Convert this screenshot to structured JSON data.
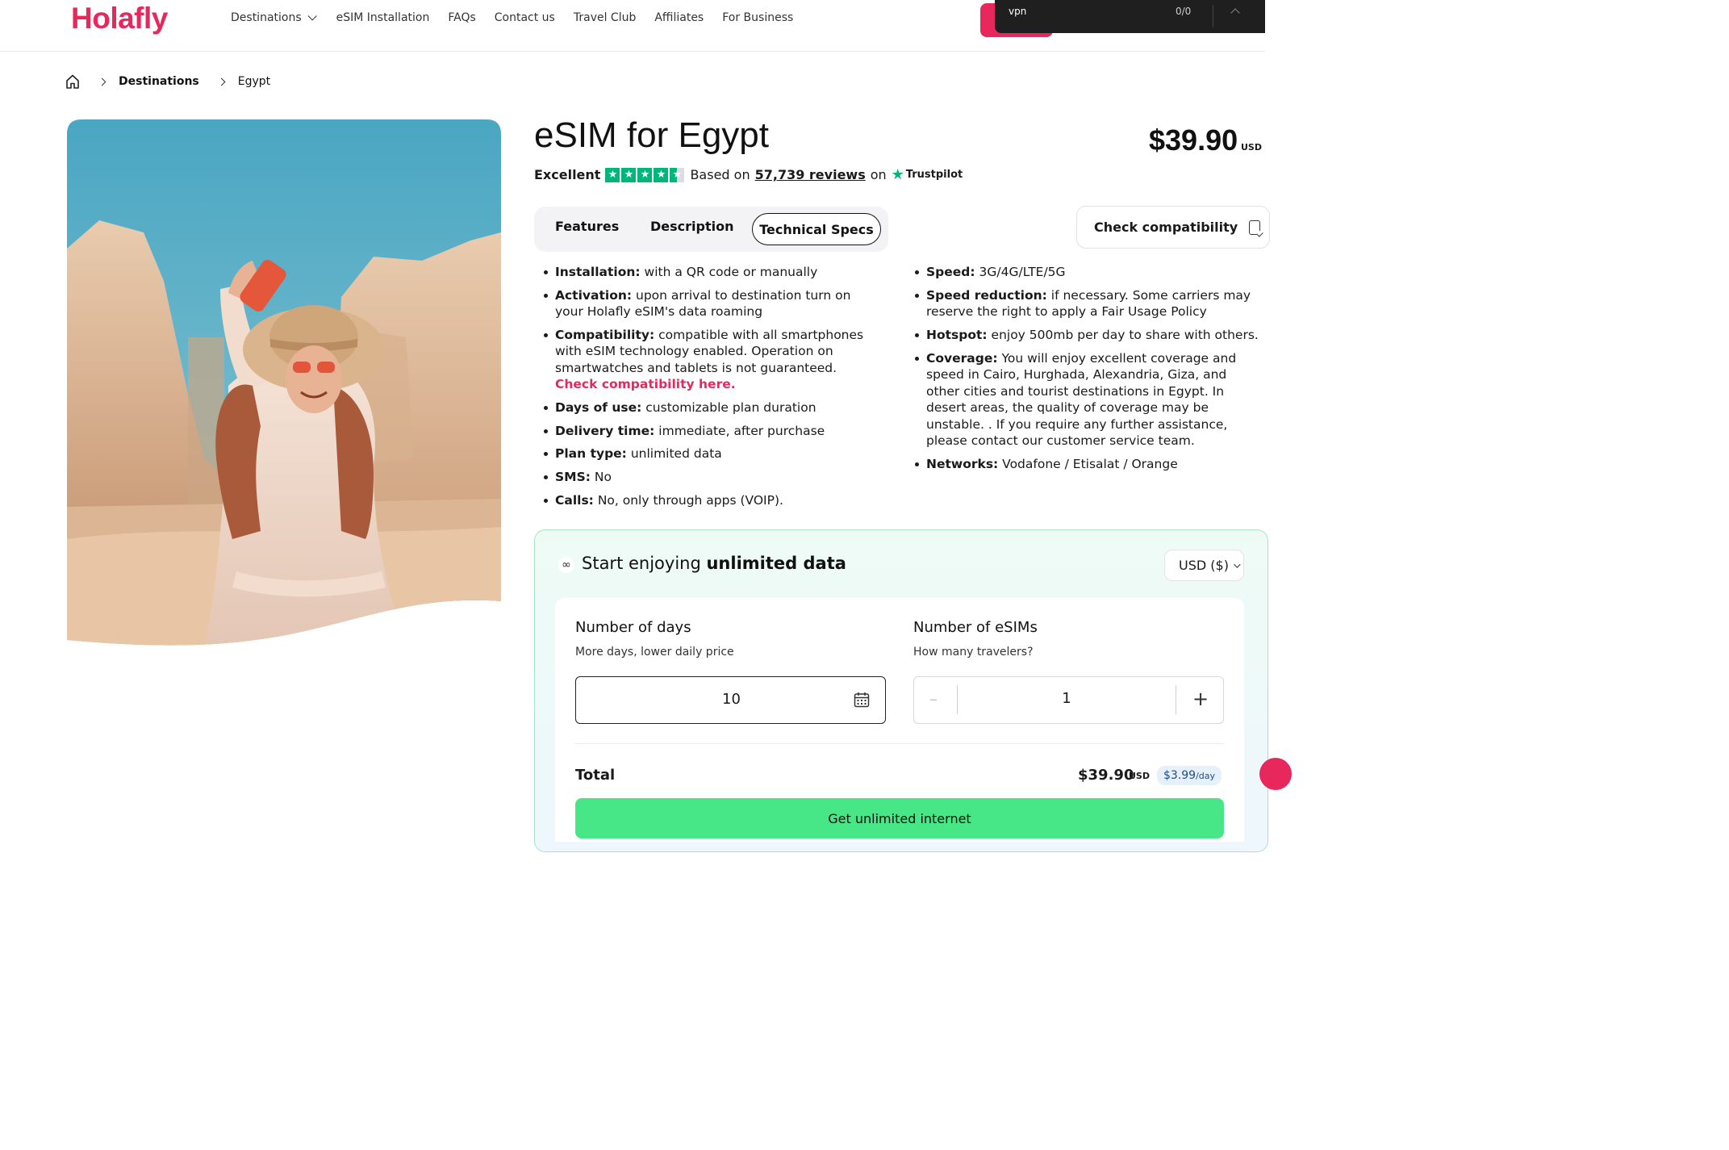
{
  "header": {
    "logo": "Holafly",
    "nav": [
      "Destinations",
      "eSIM Installation",
      "FAQs",
      "Contact us",
      "Travel Club",
      "Affiliates",
      "For Business"
    ],
    "find_bar": {
      "query": "vpn",
      "count": "0/0"
    }
  },
  "breadcrumb": {
    "items": [
      "Destinations",
      "Egypt"
    ]
  },
  "product": {
    "title": "eSIM for Egypt",
    "price": "$39.90",
    "price_currency": "USD",
    "rating": {
      "label": "Excellent",
      "based_on": "Based on",
      "reviews": "57,739 reviews",
      "on": "on",
      "provider": "Trustpilot",
      "stars": 4.5
    },
    "tabs": [
      "Features",
      "Description",
      "Technical Specs"
    ],
    "active_tab": "Technical Specs",
    "check_compatibility": "Check compatibility"
  },
  "specs": {
    "left": [
      {
        "k": "Installation:",
        "v": " with a QR code or manually"
      },
      {
        "k": "Activation:",
        "v": " upon arrival to destination turn on your Holafly eSIM's data roaming"
      },
      {
        "k": "Compatibility:",
        "v": " compatible with all smartphones with eSIM technology enabled. Operation on smartwatches and tablets is not guaranteed. ",
        "link": "Check compatibility here."
      },
      {
        "k": "Days of use:",
        "v": " customizable plan duration"
      },
      {
        "k": "Delivery time:",
        "v": " immediate, after purchase"
      },
      {
        "k": "Plan type:",
        "v": " unlimited data"
      },
      {
        "k": "SMS:",
        "v": " No"
      },
      {
        "k": "Calls:",
        "v": " No, only through apps (VOIP)."
      }
    ],
    "right": [
      {
        "k": "Speed:",
        "v": " 3G/4G/LTE/5G"
      },
      {
        "k": "Speed reduction:",
        "v": " if necessary. Some carriers may reserve the right to apply a Fair Usage Policy"
      },
      {
        "k": "Hotspot:",
        "v": " enjoy 500mb per day to share with others."
      },
      {
        "k": "Coverage:",
        "v": "  You will enjoy excellent coverage and speed in Cairo, Hurghada, Alexandria, Giza, and other cities and tourist destinations in Egypt. In desert areas, the quality of coverage may be unstable. . If you require any further assistance, please contact our customer service team."
      },
      {
        "k": "Networks:",
        "v": " Vodafone / Etisalat / Orange"
      }
    ]
  },
  "purchase": {
    "title_prefix": "Start enjoying",
    "title_bold": "unlimited data",
    "currency": "USD ($)",
    "days_title": "Number of days",
    "days_sub": "More days, lower daily price",
    "days_value": "10",
    "sims_title": "Number of eSIMs",
    "sims_sub": "How many travelers?",
    "sims_value": "1",
    "total_label": "Total",
    "total_value": "$39.90",
    "total_currency": "USD",
    "per_day": "$3.99",
    "per_day_unit": "/day",
    "cta": "Get unlimited internet"
  }
}
